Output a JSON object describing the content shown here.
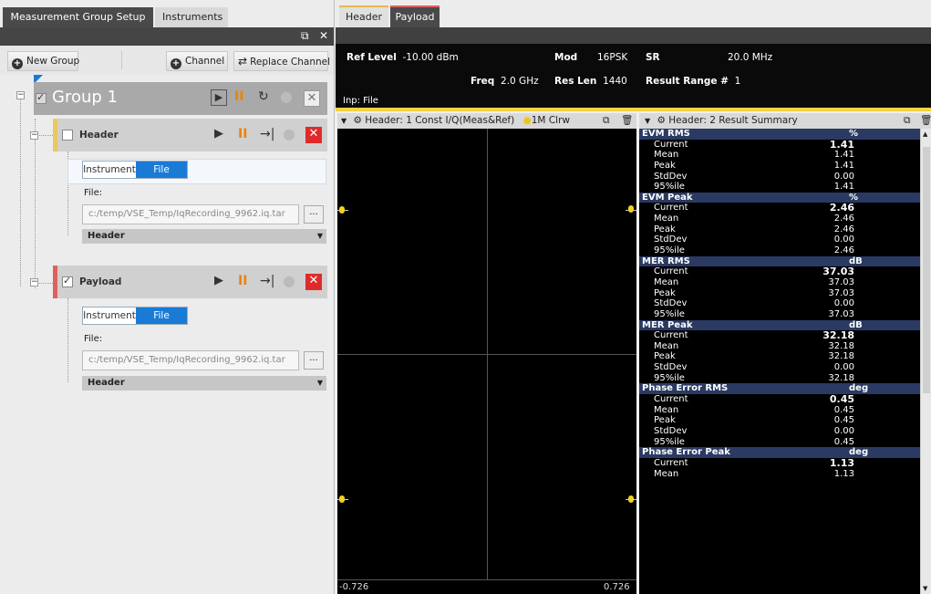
{
  "left_panel": {
    "tabs": [
      "Measurement Group Setup",
      "Instruments"
    ],
    "toolbar": {
      "new_group": "New Group",
      "channel": "Channel",
      "replace_channel": "Replace Channel"
    },
    "group": {
      "label": "Group 1",
      "checked": true
    },
    "channels": [
      {
        "name": "Header",
        "checked": false,
        "accent": "#e8c860",
        "source_options": [
          "Instrument",
          "File"
        ],
        "source_selected": "File",
        "file_label": "File:",
        "file_path": "c:/temp/VSE_Temp/IqRecording_9962.iq.tar",
        "browse": "...",
        "dropdown": "Header"
      },
      {
        "name": "Payload",
        "checked": true,
        "accent": "#e06060",
        "source_options": [
          "Instrument",
          "File"
        ],
        "source_selected": "File",
        "file_label": "File:",
        "file_path": "c:/temp/VSE_Temp/IqRecording_9962.iq.tar",
        "browse": "...",
        "dropdown": "Header"
      }
    ]
  },
  "right_tabs": [
    "Header",
    "Payload"
  ],
  "info": {
    "ref_level_label": "Ref Level",
    "ref_level": "-10.00 dBm",
    "mod_label": "Mod",
    "mod": "16PSK",
    "sr_label": "SR",
    "sr": "20.0 MHz",
    "freq_label": "Freq",
    "freq": "2.0 GHz",
    "res_len_label": "Res Len",
    "res_len": "1440",
    "result_range_label": "Result Range #",
    "result_range": "1",
    "input": "Inp: File"
  },
  "constellation": {
    "title": "Header: 1 Const I/Q(Meas&Ref)",
    "trace": "1M Clrw",
    "x_min": "-0.726",
    "x_max": "0.726"
  },
  "result_summary": {
    "title": "Header: 2 Result Summary",
    "groups": [
      {
        "name": "EVM RMS",
        "unit": "%",
        "rows": [
          [
            "Current",
            "1.41"
          ],
          [
            "Mean",
            "1.41"
          ],
          [
            "Peak",
            "1.41"
          ],
          [
            "StdDev",
            "0.00"
          ],
          [
            "95%ile",
            "1.41"
          ]
        ]
      },
      {
        "name": "EVM Peak",
        "unit": "%",
        "rows": [
          [
            "Current",
            "2.46"
          ],
          [
            "Mean",
            "2.46"
          ],
          [
            "Peak",
            "2.46"
          ],
          [
            "StdDev",
            "0.00"
          ],
          [
            "95%ile",
            "2.46"
          ]
        ]
      },
      {
        "name": "MER RMS",
        "unit": "dB",
        "rows": [
          [
            "Current",
            "37.03"
          ],
          [
            "Mean",
            "37.03"
          ],
          [
            "Peak",
            "37.03"
          ],
          [
            "StdDev",
            "0.00"
          ],
          [
            "95%ile",
            "37.03"
          ]
        ]
      },
      {
        "name": "MER Peak",
        "unit": "dB",
        "rows": [
          [
            "Current",
            "32.18"
          ],
          [
            "Mean",
            "32.18"
          ],
          [
            "Peak",
            "32.18"
          ],
          [
            "StdDev",
            "0.00"
          ],
          [
            "95%ile",
            "32.18"
          ]
        ]
      },
      {
        "name": "Phase Error RMS",
        "unit": "deg",
        "rows": [
          [
            "Current",
            "0.45"
          ],
          [
            "Mean",
            "0.45"
          ],
          [
            "Peak",
            "0.45"
          ],
          [
            "StdDev",
            "0.00"
          ],
          [
            "95%ile",
            "0.45"
          ]
        ]
      },
      {
        "name": "Phase Error Peak",
        "unit": "deg",
        "rows": [
          [
            "Current",
            "1.13"
          ],
          [
            "Mean",
            "1.13"
          ]
        ]
      }
    ]
  }
}
